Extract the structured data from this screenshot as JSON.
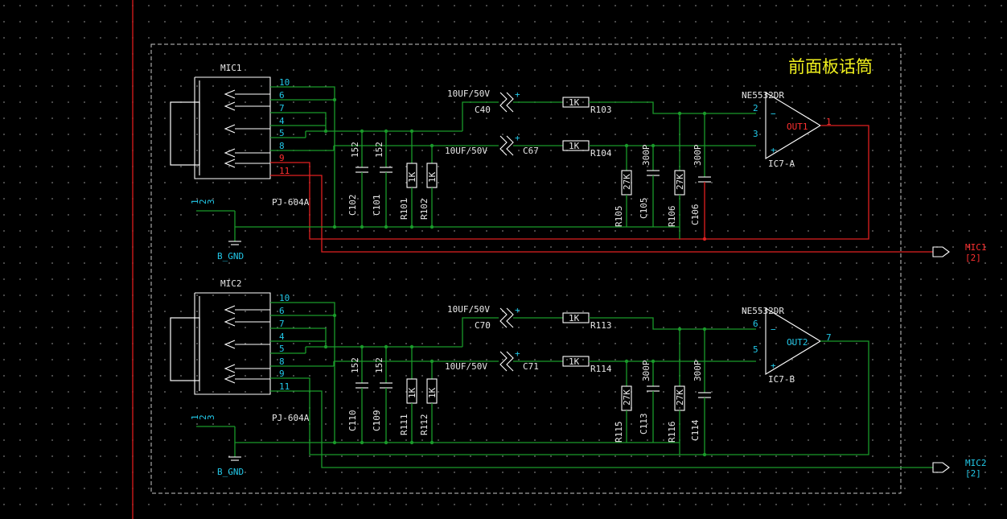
{
  "title": "前面板话筒",
  "colors": {
    "background": "#000000",
    "wire": "#1a9a2a",
    "net_red": "#e02020",
    "pin": "#22c8e8",
    "title": "#f0f01e",
    "component": "#ffffff"
  },
  "channels": [
    {
      "jack": {
        "ref": "MIC1",
        "part": "PJ-604A",
        "pins": [
          "10",
          "6",
          "7",
          "4",
          "5",
          "8",
          "9",
          "11"
        ],
        "gnd_pins": [
          "1",
          "2",
          "3"
        ]
      },
      "gnd": "B_GND",
      "caps_filter": [
        {
          "ref": "C102",
          "value": "152"
        },
        {
          "ref": "C101",
          "value": "152"
        }
      ],
      "res_pulldown": [
        {
          "ref": "R101",
          "value": "1K"
        },
        {
          "ref": "R102",
          "value": "1K"
        }
      ],
      "caps_coupling": [
        {
          "ref": "C40",
          "value": "10UF/50V"
        },
        {
          "ref": "C67",
          "value": "10UF/50V"
        }
      ],
      "res_series": [
        {
          "ref": "R103",
          "value": "1K"
        },
        {
          "ref": "R104",
          "value": "1K"
        }
      ],
      "res_fb": [
        {
          "ref": "R105",
          "value": "27K"
        },
        {
          "ref": "R106",
          "value": "27K"
        }
      ],
      "caps_fb": [
        {
          "ref": "C105",
          "value": "300P"
        },
        {
          "ref": "C106",
          "value": "300P"
        }
      ],
      "opamp": {
        "part": "NE5532DR",
        "ref": "IC7-A",
        "pin_inv": "2",
        "pin_noninv": "3",
        "out_label": "OUT1",
        "out_pin": "1"
      },
      "port": {
        "name": "MIC1",
        "sheet": "[2]"
      }
    },
    {
      "jack": {
        "ref": "MIC2",
        "part": "PJ-604A",
        "pins": [
          "10",
          "6",
          "7",
          "4",
          "5",
          "8",
          "9",
          "11"
        ],
        "gnd_pins": [
          "1",
          "2",
          "3"
        ]
      },
      "gnd": "B_GND",
      "caps_filter": [
        {
          "ref": "C110",
          "value": "152"
        },
        {
          "ref": "C109",
          "value": "152"
        }
      ],
      "res_pulldown": [
        {
          "ref": "R111",
          "value": "1K"
        },
        {
          "ref": "R112",
          "value": "1K"
        }
      ],
      "caps_coupling": [
        {
          "ref": "C70",
          "value": "10UF/50V"
        },
        {
          "ref": "C71",
          "value": "10UF/50V"
        }
      ],
      "res_series": [
        {
          "ref": "R113",
          "value": "1K"
        },
        {
          "ref": "R114",
          "value": "1K"
        }
      ],
      "res_fb": [
        {
          "ref": "R115",
          "value": "27K"
        },
        {
          "ref": "R116",
          "value": "27K"
        }
      ],
      "caps_fb": [
        {
          "ref": "C113",
          "value": "300P"
        },
        {
          "ref": "C114",
          "value": "300P"
        }
      ],
      "opamp": {
        "part": "NE5532DR",
        "ref": "IC7-B",
        "pin_inv": "6",
        "pin_noninv": "5",
        "out_label": "OUT2",
        "out_pin": "7"
      },
      "port": {
        "name": "MIC2",
        "sheet": "[2]"
      }
    }
  ]
}
